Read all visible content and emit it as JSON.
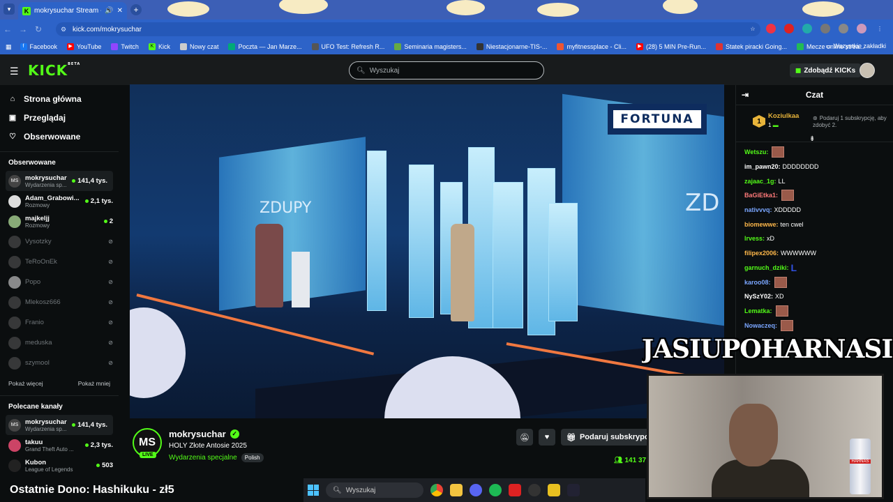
{
  "browser": {
    "tab_title": "mokrysuchar Stream - Watch",
    "url": "kick.com/mokrysuchar",
    "bookmarks": [
      "Facebook",
      "YouTube",
      "Twitch",
      "Kick",
      "Nowy czat",
      "Poczta — Jan Marze...",
      "UFO Test: Refresh R...",
      "Seminaria magisters...",
      "Niestacjonarne-TIS-...",
      "myfitnessplace - Cli...",
      "(28) 5 MIN Pre-Run...",
      "Statek piracki Going...",
      "Mecze online strea..."
    ],
    "all_bookmarks": "Wszystkie zakładki"
  },
  "header": {
    "logo": "KICK",
    "logo_badge": "BETA",
    "search_placeholder": "Wyszukaj",
    "get_kicks": "Zdobądź KICKs"
  },
  "sidebar": {
    "nav": [
      {
        "label": "Strona główna",
        "icon": "home-icon"
      },
      {
        "label": "Przeglądaj",
        "icon": "browse-icon"
      },
      {
        "label": "Obserwowane",
        "icon": "heart-icon"
      }
    ],
    "followed_title": "Obserwowane",
    "followed": [
      {
        "name": "mokrysuchar",
        "category": "Wydarzenia sp...",
        "viewers": "141,4 tys.",
        "live": true
      },
      {
        "name": "Adam_Grabowi...",
        "category": "Rozmowy",
        "viewers": "2,1 tys.",
        "live": true
      },
      {
        "name": "majkeljj",
        "category": "Rozmowy",
        "viewers": "2",
        "live": true
      },
      {
        "name": "Vysotzky",
        "live": false
      },
      {
        "name": "TeRoOnEk",
        "live": false
      },
      {
        "name": "Popo",
        "live": false
      },
      {
        "name": "Mlekosz666",
        "live": false
      },
      {
        "name": "Franio",
        "live": false
      },
      {
        "name": "meduska",
        "live": false
      },
      {
        "name": "szymool",
        "live": false
      }
    ],
    "show_more": "Pokaż więcej",
    "show_less": "Pokaż mniej",
    "recommended_title": "Polecane kanały",
    "recommended": [
      {
        "name": "mokrysuchar",
        "category": "Wydarzenia sp...",
        "viewers": "141,4 tys."
      },
      {
        "name": "takuu",
        "category": "Grand Theft Auto ...",
        "viewers": "2,3 tys."
      },
      {
        "name": "Kubon",
        "category": "League of Legends",
        "viewers": "503"
      }
    ]
  },
  "stream": {
    "streamer": "mokrysuchar",
    "avatar_initials": "MS",
    "live_badge": "LIVE",
    "title": "HOLY Złote Antosie 2025",
    "category": "Wydarzenia specjalne",
    "language": "Polish",
    "subscribe_label": "Podaruj subskrypcję",
    "viewer_count": "141 37",
    "video_brand": "FORTUNA",
    "video_text": "ZDUPY"
  },
  "chat": {
    "title": "Czat",
    "pinned": {
      "rank": "1",
      "user": "Koziulkaa",
      "count": "1",
      "description": "Podaruj 1 subskrypcję, aby zdobyć 2."
    },
    "messages": [
      {
        "user": "Wetszu:",
        "text": "",
        "emote": true,
        "color": "#53fc18"
      },
      {
        "user": "im_pawn20:",
        "text": "DDDDDDDD",
        "emote": false,
        "color": "#ffffff"
      },
      {
        "user": "zajaac_1g:",
        "text": "LL",
        "emote": false,
        "color": "#53fc18"
      },
      {
        "user": "BaGiEtka1:",
        "text": "",
        "emote": true,
        "color": "#ff7a7a"
      },
      {
        "user": "nativvvq:",
        "text": "XDDDDD",
        "emote": false,
        "color": "#7aa6ff"
      },
      {
        "user": "biomewwe:",
        "text": "ten cwel",
        "emote": false,
        "color": "#ffb84a"
      },
      {
        "user": "lrvess:",
        "text": "xD",
        "emote": false,
        "color": "#53fc18"
      },
      {
        "user": "filipex2006:",
        "text": "WWWWWW",
        "emote": false,
        "color": "#ffb84a"
      },
      {
        "user": "garnuch_dziki:",
        "text": "L",
        "emote": false,
        "color": "#53fc18",
        "bigL": true
      },
      {
        "user": "karoo08:",
        "text": "",
        "emote": true,
        "color": "#7aa6ff"
      },
      {
        "user": "NySzY02:",
        "text": "XD",
        "emote": false,
        "color": "#ffffff"
      },
      {
        "user": "Lematka:",
        "text": "",
        "emote": true,
        "color": "#53fc18"
      },
      {
        "user": "Nowaczeq:",
        "text": "",
        "emote": true,
        "color": "#7aa6ff"
      }
    ]
  },
  "overlay": {
    "cam_title": "JASIUPOHARNASIU",
    "can_label": "HARNAŚ",
    "last_donation": "Ostatnie Dono: Hashikuku - zł5"
  },
  "taskbar": {
    "search": "Wyszukaj"
  }
}
